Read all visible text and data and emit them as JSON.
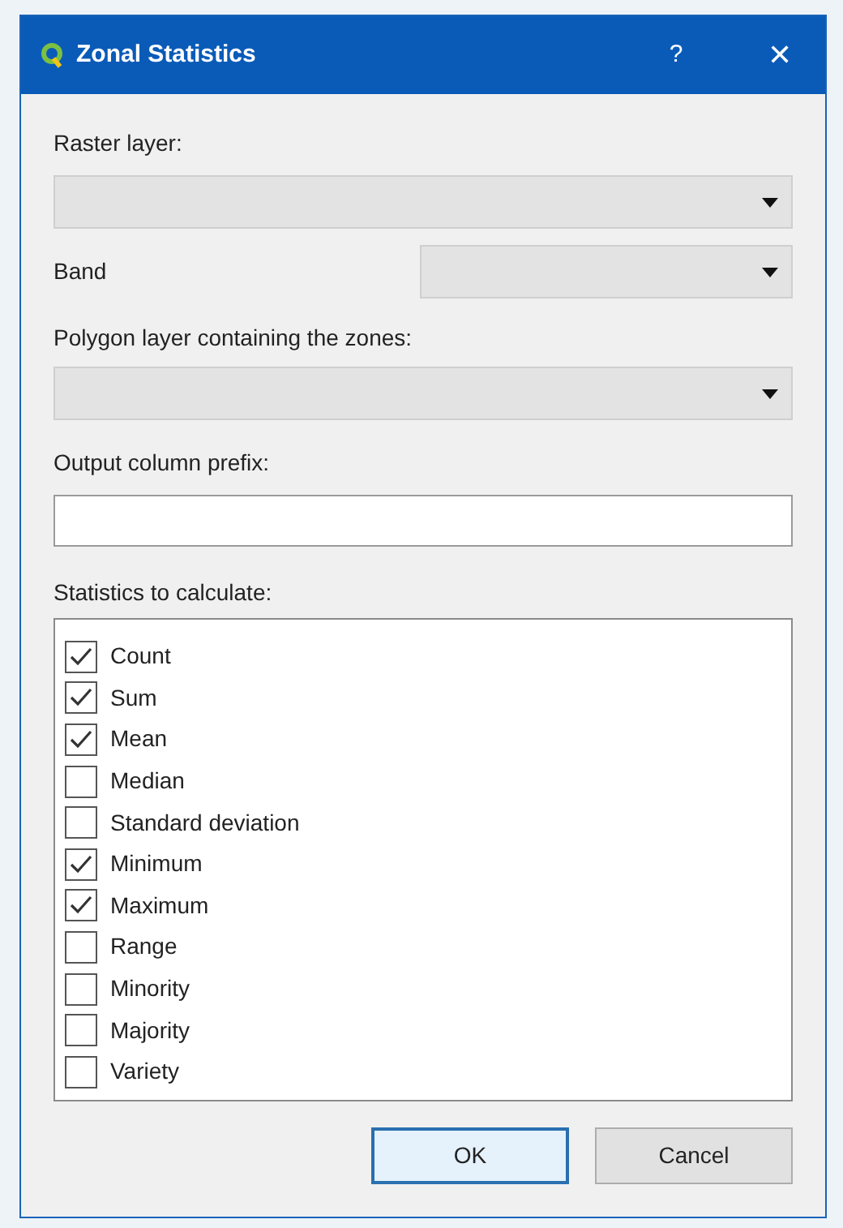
{
  "window": {
    "title": "Zonal Statistics",
    "help": "?",
    "close": "✕"
  },
  "raster_layer": {
    "label": "Raster layer:"
  },
  "band": {
    "label": "Band"
  },
  "polygon_layer": {
    "label": "Polygon layer containing the zones:"
  },
  "output_prefix": {
    "label": "Output column prefix:"
  },
  "statistics": {
    "label": "Statistics to calculate:",
    "items": [
      {
        "label": "Count",
        "checked": true
      },
      {
        "label": "Sum",
        "checked": true
      },
      {
        "label": "Mean",
        "checked": true
      },
      {
        "label": "Median",
        "checked": false
      },
      {
        "label": "Standard deviation",
        "checked": false
      },
      {
        "label": "Minimum",
        "checked": true
      },
      {
        "label": "Maximum",
        "checked": true
      },
      {
        "label": "Range",
        "checked": false
      },
      {
        "label": "Minority",
        "checked": false
      },
      {
        "label": "Majority",
        "checked": false
      },
      {
        "label": "Variety",
        "checked": false
      }
    ]
  },
  "buttons": [
    {
      "label": "OK",
      "kind": "default"
    },
    {
      "label": "Cancel",
      "kind": "normal"
    }
  ]
}
